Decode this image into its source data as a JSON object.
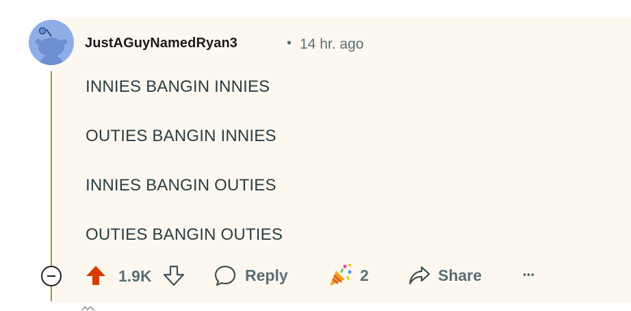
{
  "comment": {
    "author": "JustAGuyNamedRyan3",
    "separator": "•",
    "timestamp": "14 hr. ago",
    "lines": [
      "INNIES BANGIN INNIES",
      "OUTIES BANGIN INNIES",
      "INNIES BANGIN OUTIES",
      "OUTIES BANGIN OUTIES"
    ]
  },
  "actions": {
    "score": "1.9K",
    "reply_label": "Reply",
    "award_count": "2",
    "share_label": "Share",
    "more_label": "•••"
  },
  "colors": {
    "upvote_active": "#d93a00",
    "thread_line": "#b98d1a",
    "comment_background": "#fdf8ef",
    "meta_text": "#576f76"
  },
  "icons": {
    "avatar": "snoo-avatar",
    "collapse": "collapse-minus-icon",
    "upvote": "upvote-arrow-icon",
    "downvote": "downvote-arrow-icon",
    "reply": "speech-bubble-icon",
    "award": "party-popper-icon",
    "share": "share-arrow-icon",
    "more": "ellipsis-icon"
  }
}
